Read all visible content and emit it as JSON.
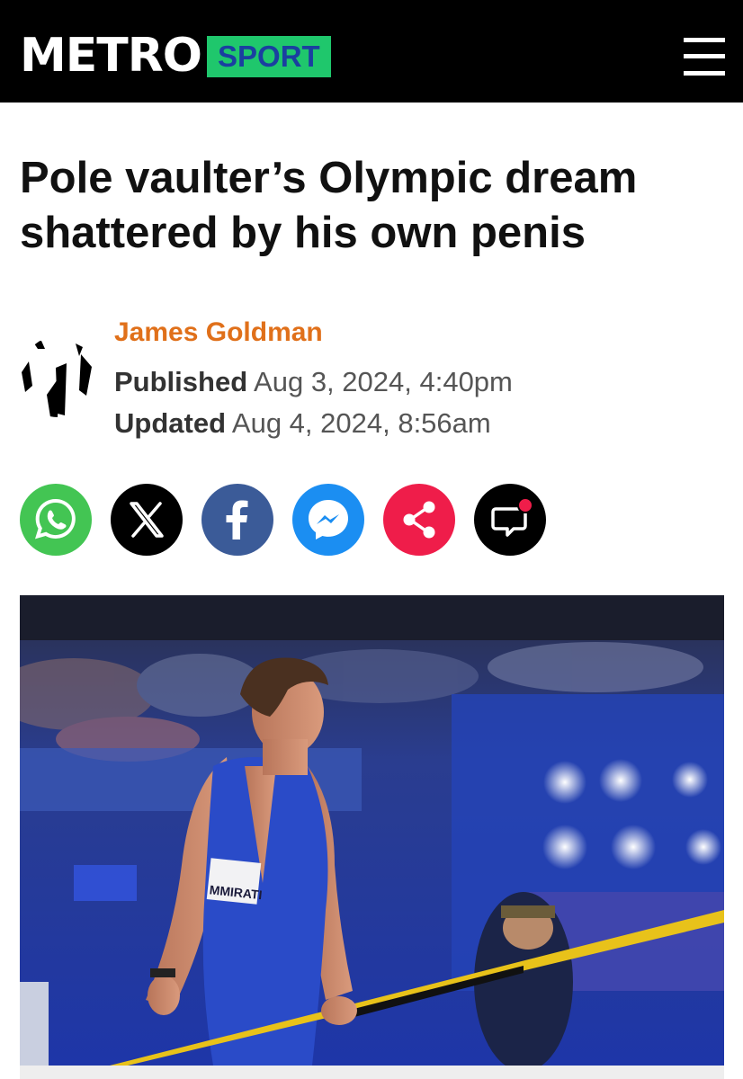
{
  "header": {
    "logo_text": "METRO",
    "section_tag": "SPORT",
    "menu_icon": "hamburger-menu-icon"
  },
  "article": {
    "headline": "Pole vaulter’s Olympic dream shattered by his own penis",
    "author": "James Goldman",
    "published_label": "Published",
    "published_value": "Aug 3, 2024, 4:40pm",
    "updated_label": "Updated",
    "updated_value": "Aug 4, 2024, 8:56am"
  },
  "share_buttons": [
    {
      "icon": "whatsapp-icon",
      "color": "#43c553"
    },
    {
      "icon": "x-icon",
      "color": "#000000"
    },
    {
      "icon": "facebook-icon",
      "color": "#3b5b98"
    },
    {
      "icon": "messenger-icon",
      "color": "#1b8ef2"
    },
    {
      "icon": "share-icon",
      "color": "#ef1d4a"
    },
    {
      "icon": "comments-icon",
      "color": "#000000",
      "badge_color": "#ef1d4a"
    }
  ],
  "hero_image": {
    "description_icon": "athlete-photo",
    "bib_text": "MMIRATI"
  },
  "colors": {
    "header_bg": "#000000",
    "sport_tag_bg": "#1fc76c",
    "sport_tag_text": "#1a3fa0",
    "author": "#e0701a"
  }
}
